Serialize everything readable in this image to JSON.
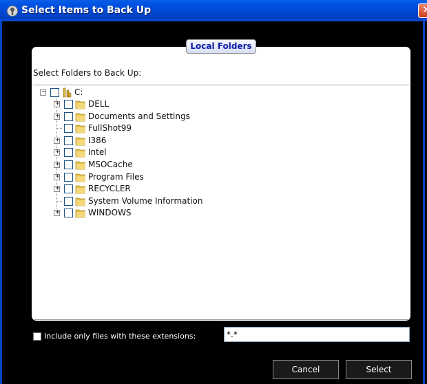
{
  "window": {
    "title": "Select Items to Back Up",
    "close_glyph": "✕"
  },
  "panel": {
    "tab_label": "Local Folders",
    "heading": "Select Folders to Back Up:"
  },
  "tree": {
    "root": {
      "label": "C:",
      "expander": "−",
      "checked": false
    },
    "children": [
      {
        "label": "DELL",
        "expander": "+",
        "checked": false
      },
      {
        "label": "Documents and Settings",
        "expander": "+",
        "checked": false
      },
      {
        "label": "FullShot99",
        "expander": "",
        "checked": false
      },
      {
        "label": "I386",
        "expander": "+",
        "checked": false
      },
      {
        "label": "Intel",
        "expander": "+",
        "checked": false
      },
      {
        "label": "MSOCache",
        "expander": "+",
        "checked": false
      },
      {
        "label": "Program Files",
        "expander": "+",
        "checked": false
      },
      {
        "label": "RECYCLER",
        "expander": "+",
        "checked": false
      },
      {
        "label": "System Volume Information",
        "expander": "",
        "checked": false
      },
      {
        "label": "WINDOWS",
        "expander": "+",
        "checked": false
      }
    ]
  },
  "extensions": {
    "checkbox_label": "Include only files with these extensions:",
    "checked": false,
    "value": "*.*"
  },
  "buttons": {
    "cancel": "Cancel",
    "select": "Select"
  },
  "colors": {
    "titlebar": "#0055e5",
    "tab_text": "#0f1ea8",
    "folder": "#e8c34a"
  }
}
